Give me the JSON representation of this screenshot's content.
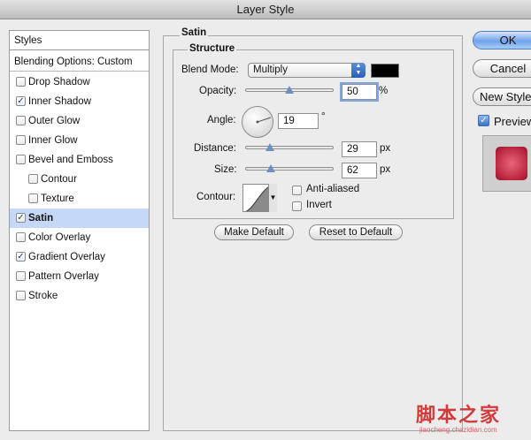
{
  "window": {
    "title": "Layer Style"
  },
  "sidebar": {
    "header": "Styles",
    "blending_options": "Blending Options: Custom",
    "items": [
      {
        "label": "Drop Shadow",
        "checked": false
      },
      {
        "label": "Inner Shadow",
        "checked": true
      },
      {
        "label": "Outer Glow",
        "checked": false
      },
      {
        "label": "Inner Glow",
        "checked": false
      },
      {
        "label": "Bevel and Emboss",
        "checked": false
      },
      {
        "label": "Contour",
        "checked": false
      },
      {
        "label": "Texture",
        "checked": false
      },
      {
        "label": "Satin",
        "checked": true,
        "selected": true
      },
      {
        "label": "Color Overlay",
        "checked": false
      },
      {
        "label": "Gradient Overlay",
        "checked": true
      },
      {
        "label": "Pattern Overlay",
        "checked": false
      },
      {
        "label": "Stroke",
        "checked": false
      }
    ]
  },
  "satin": {
    "section_title": "Satin",
    "structure_title": "Structure",
    "blend_mode_label": "Blend Mode:",
    "blend_mode_value": "Multiply",
    "blend_color": "#000000",
    "opacity_label": "Opacity:",
    "opacity_value": "50",
    "opacity_unit": "%",
    "opacity_level": 0.5,
    "angle_label": "Angle:",
    "angle_value": "19",
    "angle_unit": "°",
    "distance_label": "Distance:",
    "distance_value": "29",
    "distance_unit": "px",
    "size_label": "Size:",
    "size_value": "62",
    "size_unit": "px",
    "contour_label": "Contour:",
    "anti_aliased_label": "Anti-aliased",
    "anti_aliased_checked": false,
    "invert_label": "Invert",
    "invert_checked": false,
    "make_default": "Make Default",
    "reset_default": "Reset to Default"
  },
  "buttons": {
    "ok": "OK",
    "cancel": "Cancel",
    "new_style": "New Style...",
    "preview_label": "Preview",
    "preview_checked": true
  },
  "preview_color": "#cc3a50",
  "watermark": {
    "text": "脚本之家",
    "url": "jiaocheng.chazidian.com"
  }
}
